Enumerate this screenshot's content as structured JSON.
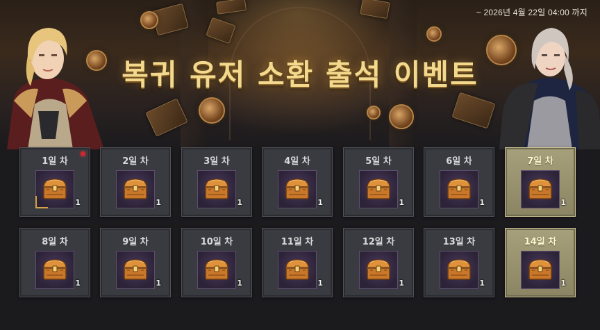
{
  "event": {
    "deadline": "~ 2026년 4월 22일 04:00 까지",
    "title": "복귀 유저 소환 출석 이벤트"
  },
  "days": [
    {
      "label": "1일 차",
      "reward_icon": "treasure-chest-icon",
      "qty": "1",
      "special": false,
      "alert": true
    },
    {
      "label": "2일 차",
      "reward_icon": "treasure-chest-icon",
      "qty": "1",
      "special": false,
      "alert": false
    },
    {
      "label": "3일 차",
      "reward_icon": "treasure-chest-icon",
      "qty": "1",
      "special": false,
      "alert": false
    },
    {
      "label": "4일 차",
      "reward_icon": "treasure-chest-icon",
      "qty": "1",
      "special": false,
      "alert": false
    },
    {
      "label": "5일 차",
      "reward_icon": "treasure-chest-icon",
      "qty": "1",
      "special": false,
      "alert": false
    },
    {
      "label": "6일 차",
      "reward_icon": "treasure-chest-icon",
      "qty": "1",
      "special": false,
      "alert": false
    },
    {
      "label": "7일 차",
      "reward_icon": "treasure-chest-icon",
      "qty": "1",
      "special": true,
      "alert": false
    },
    {
      "label": "8일 차",
      "reward_icon": "treasure-chest-icon",
      "qty": "1",
      "special": false,
      "alert": false
    },
    {
      "label": "9일 차",
      "reward_icon": "treasure-chest-icon",
      "qty": "1",
      "special": false,
      "alert": false
    },
    {
      "label": "10일 차",
      "reward_icon": "treasure-chest-icon",
      "qty": "1",
      "special": false,
      "alert": false
    },
    {
      "label": "11일 차",
      "reward_icon": "treasure-chest-icon",
      "qty": "1",
      "special": false,
      "alert": false
    },
    {
      "label": "12일 차",
      "reward_icon": "treasure-chest-icon",
      "qty": "1",
      "special": false,
      "alert": false
    },
    {
      "label": "13일 차",
      "reward_icon": "treasure-chest-icon",
      "qty": "1",
      "special": false,
      "alert": false
    },
    {
      "label": "14일 차",
      "reward_icon": "treasure-chest-icon",
      "qty": "1",
      "special": true,
      "alert": false
    }
  ],
  "colors": {
    "title_gold": "#f3d98d",
    "special_day_bg": "#a7a07c",
    "normal_day_bg": "#3a3b40",
    "slot_purple": "#2c2338",
    "alert_red": "#d1262d"
  }
}
